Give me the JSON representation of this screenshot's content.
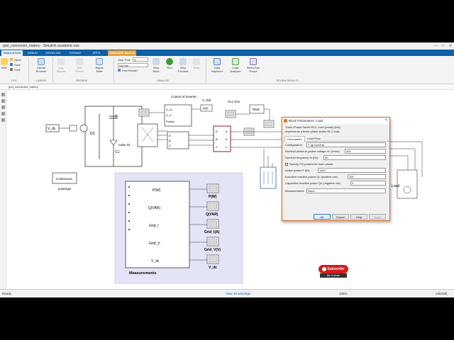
{
  "window": {
    "title": "grid_connected_battery - Simulink academic use",
    "controls": [
      "—",
      "□",
      "✕"
    ]
  },
  "ribbon": {
    "tabs": [
      "SIMULATION",
      "DEBUG",
      "MODELING",
      "FORMAT",
      "APPS",
      "SIMSCAPE BLOCK"
    ],
    "file": {
      "new_label": "New",
      "open_label": "Open",
      "save_label": "Save",
      "print_label": "Print",
      "section": "FILE"
    },
    "library": {
      "browser_label": "Library Browser",
      "section": "LIBRARY"
    },
    "prepare": {
      "log_signals": "Log Signals",
      "add_viewer": "Add Viewer",
      "signal_table": "Signal Table",
      "section": "PREPARE"
    },
    "simulate": {
      "stop_time_label": "Stop Time",
      "stop_time_value": "5",
      "mode_value": "Normal",
      "fast_restart": "Fast Restart",
      "step_back": "Step Back",
      "run": "Run",
      "step_forward": "Step Forward",
      "stop": "Stop",
      "section": "SIMULATE"
    },
    "review": {
      "data_inspector": "Data Inspector",
      "logic_analyzer": "Logic Analyzer",
      "birds_eye": "Bird's-Eye Scope",
      "section": "REVIEW RESULTS"
    }
  },
  "address": {
    "model_path": "grid_connected_battery"
  },
  "diagram": {
    "v_dc_source": "V_dc",
    "dc_label": "DC",
    "c_label": "C",
    "c1_label": "C1",
    "node_label": "node 10",
    "control_title": "Control of Inverter",
    "control_ports": [
      "V_LL",
      "U_V",
      "Pulses"
    ],
    "v_ref_label": "V_Ref",
    "v_ref_value": "400",
    "vll_rms": "VLL-rms",
    "rms_label": "RMS",
    "bridge_ports_in": [
      "A",
      "B",
      "C"
    ],
    "bridge_ports_out": [
      "a",
      "b",
      "c"
    ],
    "powergui_block": "Continuous",
    "powergui_label": "powergui",
    "load_label": "Load",
    "measurements": {
      "title": "Measurements",
      "outputs": [
        "P(W)",
        "Q(VAR)",
        "Grid_I",
        "Grid_V",
        "V_dc"
      ],
      "scopes": [
        "P(W)",
        "Q(VAR)",
        "Grid_I(A)",
        "Grid_V(V)",
        "V_dc"
      ]
    }
  },
  "dialog": {
    "title": "Block Parameters: Load",
    "block_type": "Three-Phase Series RLC Load (mask) (link)",
    "description": "Implements a three-phase series RLC load.",
    "tabs": [
      "Parameters",
      "Load Flow"
    ],
    "configuration_label": "Configuration",
    "configuration_value": "Y (grounded)",
    "vn_label": "Nominal phase-to-phase voltage Vn (Vrms)",
    "vn_value": "400",
    "fn_label": "Nominal frequency fn (Hz):",
    "fn_value": "50",
    "specify_pq_label": "Specify PQ powers for each phase",
    "p_label": "Active power P (W):",
    "p_value": "10e3",
    "ql_label": "Inductive reactive power QL (positive var):",
    "ql_value": "100",
    "qc_label": "Capacitive reactive power Qc (negative var):",
    "qc_value": "0",
    "measurements_label": "Measurements",
    "measurements_value": "None",
    "buttons": [
      "OK",
      "Cancel",
      "Help",
      "Apply"
    ]
  },
  "statusbar": {
    "ready": "Ready",
    "warnings": "View 16 warnings",
    "zoom": "135%",
    "solver": "ode23tb"
  },
  "overlay": {
    "subscribe": "Subscribe",
    "like_share": "like & share"
  },
  "colors": {
    "ribbon_blue": "#0d5fa6",
    "simscape_tab": "#e8a23a",
    "measurements_bg": "#e4e4f7",
    "bridge_border": "#8b1a3c",
    "subscribe_red": "#d31d1d"
  }
}
